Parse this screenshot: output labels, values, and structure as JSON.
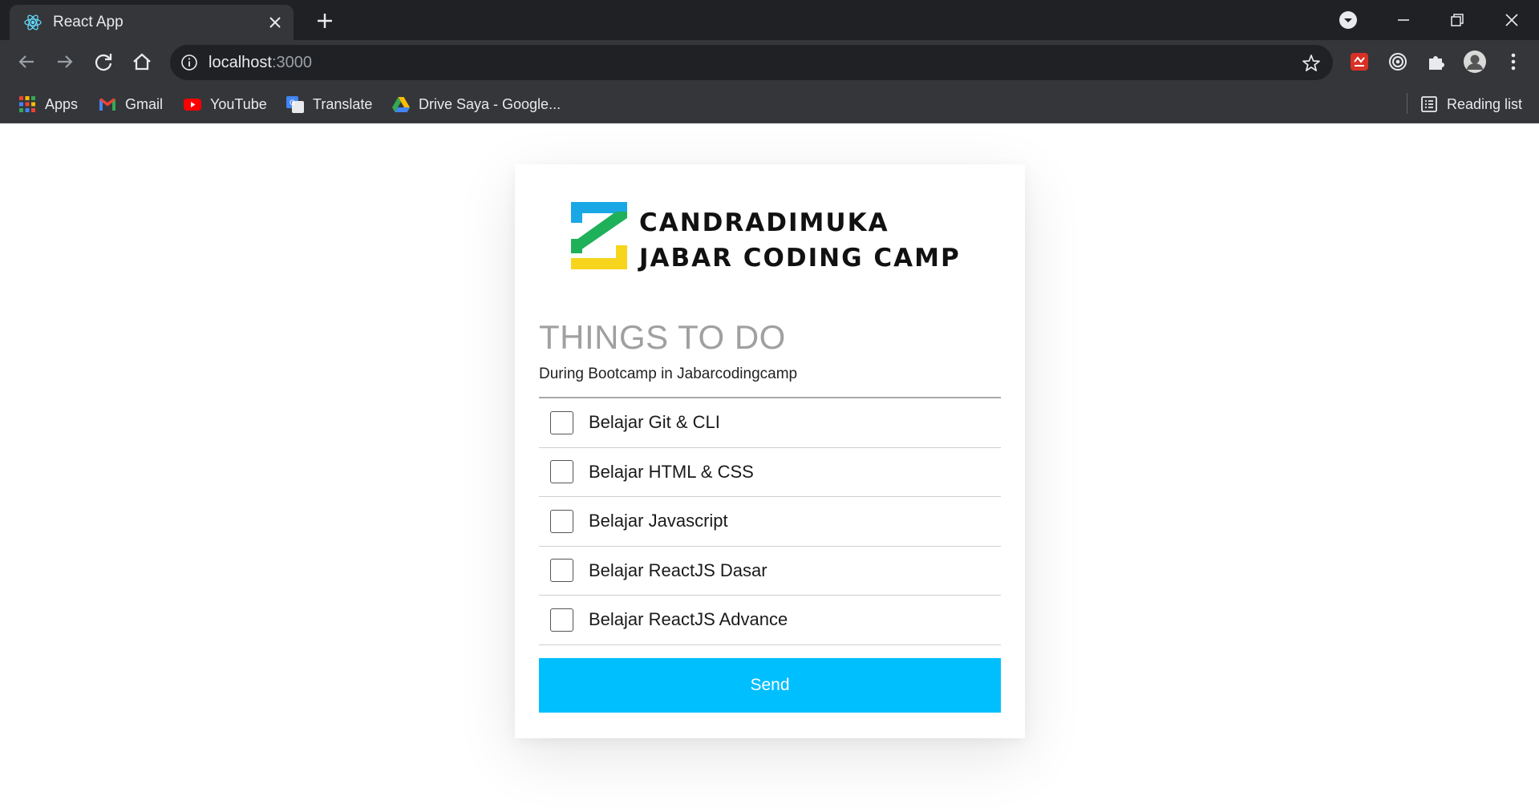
{
  "browser": {
    "tab": {
      "title": "React App",
      "favicon": "react-icon"
    },
    "address": {
      "host": "localhost",
      "port": ":3000"
    },
    "bookmarks": [
      {
        "label": "Apps",
        "icon": "apps-grid-icon"
      },
      {
        "label": "Gmail",
        "icon": "gmail-icon"
      },
      {
        "label": "YouTube",
        "icon": "youtube-icon"
      },
      {
        "label": "Translate",
        "icon": "translate-icon"
      },
      {
        "label": "Drive Saya - Google...",
        "icon": "google-drive-icon"
      }
    ],
    "reading_list": {
      "label": "Reading list",
      "icon": "reading-list-icon"
    }
  },
  "card": {
    "logo": {
      "line1": "CANDRADIMUKA",
      "line2": "JABAR CODING CAMP"
    },
    "title": "THINGS TO DO",
    "subtitle": "During Bootcamp in Jabarcodingcamp",
    "todos": [
      {
        "label": "Belajar Git & CLI",
        "checked": false
      },
      {
        "label": "Belajar HTML & CSS",
        "checked": false
      },
      {
        "label": "Belajar Javascript",
        "checked": false
      },
      {
        "label": "Belajar ReactJS Dasar",
        "checked": false
      },
      {
        "label": "Belajar ReactJS Advance",
        "checked": false
      }
    ],
    "send_label": "Send"
  },
  "colors": {
    "accent": "#00bfff",
    "heading": "#a0a0a0",
    "logo_blue": "#1aa7e6",
    "logo_green": "#1fb05a",
    "logo_yellow": "#f7d51d"
  }
}
